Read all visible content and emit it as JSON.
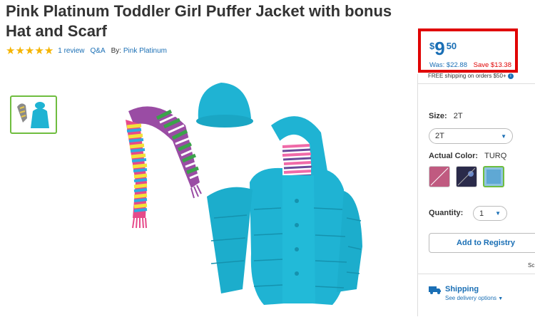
{
  "product": {
    "title": "Pink Platinum Toddler Girl Puffer Jacket with bonus Hat and Scarf",
    "rating_stars": 5,
    "reviews_link": "1 review",
    "qa_link": "Q&A",
    "by_label": "By:",
    "brand": "Pink Platinum"
  },
  "price": {
    "currency": "$",
    "dollars": "9",
    "cents": "50",
    "was": "Was: $22.88",
    "save": "Save $13.38",
    "free_shipping": "FREE shipping on orders $50+"
  },
  "options": {
    "size_label": "Size:",
    "size_value": "2T",
    "size_selected": "2T",
    "color_label": "Actual Color:",
    "color_value": "TURQ",
    "quantity_label": "Quantity:",
    "quantity_value": "1"
  },
  "actions": {
    "registry_button": "Add to Registry"
  },
  "shipping": {
    "label": "Shipping",
    "delivery_options": "See delivery options",
    "truncated": "Sc"
  },
  "colors": {
    "accent_blue": "#1a6fb5",
    "highlight_red": "#e00000",
    "selected_green": "#6fbd3f",
    "jacket_turquoise": "#1fb3d3"
  },
  "icons": [
    "star-icon",
    "chevron-down-icon",
    "truck-icon",
    "info-icon"
  ]
}
